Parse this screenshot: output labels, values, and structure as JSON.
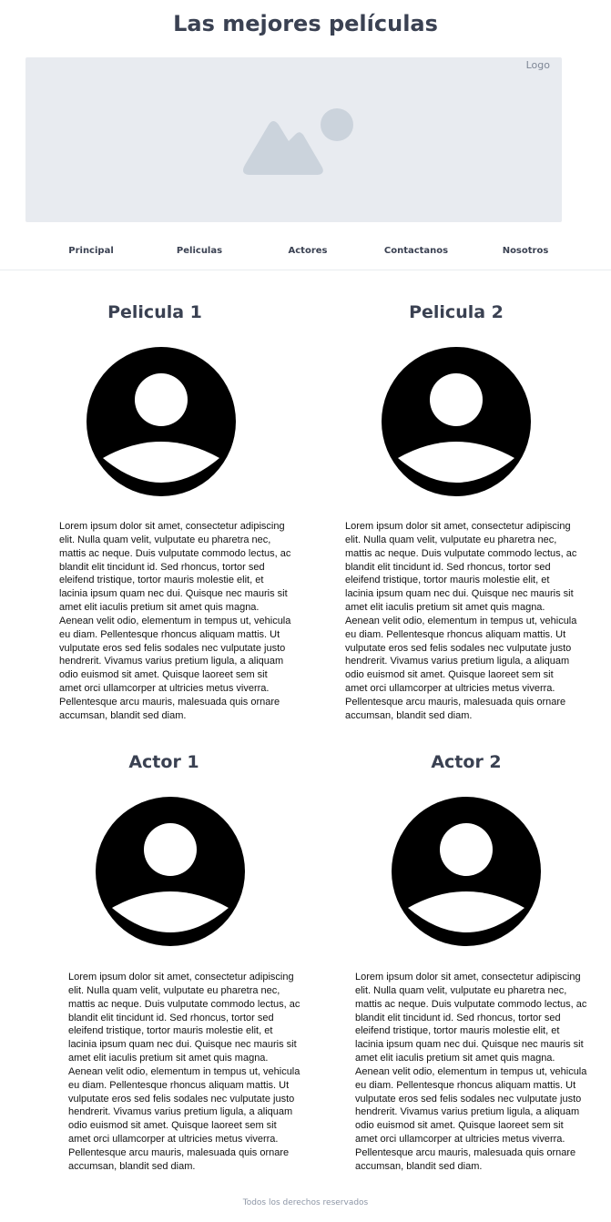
{
  "header": {
    "title": "Las mejores películas"
  },
  "banner": {
    "logo_label": "Logo",
    "image_icon": "image-placeholder-icon"
  },
  "nav": {
    "items": [
      {
        "label": "Principal"
      },
      {
        "label": "Peliculas"
      },
      {
        "label": "Actores"
      },
      {
        "label": "Contactanos"
      },
      {
        "label": "Nosotros"
      }
    ]
  },
  "cards": [
    {
      "title": "Pelicula 1",
      "icon": "user-avatar-icon",
      "text": "Lorem ipsum dolor sit amet, consectetur adipiscing elit. Nulla quam velit, vulputate eu pharetra nec, mattis ac neque. Duis vulputate commodo lectus, ac blandit elit tincidunt id. Sed rhoncus, tortor sed eleifend tristique, tortor mauris molestie elit, et lacinia ipsum quam nec dui. Quisque nec mauris sit amet elit iaculis pretium sit amet quis magna. Aenean velit odio, elementum in tempus ut, vehicula eu diam. Pellentesque rhoncus aliquam mattis. Ut vulputate eros sed felis sodales nec vulputate justo hendrerit. Vivamus varius pretium ligula, a aliquam odio euismod sit amet. Quisque laoreet sem sit amet orci ullamcorper at ultricies metus viverra. Pellentesque arcu mauris, malesuada quis ornare accumsan, blandit sed diam."
    },
    {
      "title": "Pelicula 2",
      "icon": "user-avatar-icon",
      "text": "Lorem ipsum dolor sit amet, consectetur adipiscing elit. Nulla quam velit, vulputate eu pharetra nec, mattis ac neque. Duis vulputate commodo lectus, ac blandit elit tincidunt id. Sed rhoncus, tortor sed eleifend tristique, tortor mauris molestie elit, et lacinia ipsum quam nec dui. Quisque nec mauris sit amet elit iaculis pretium sit amet quis magna. Aenean velit odio, elementum in tempus ut, vehicula eu diam. Pellentesque rhoncus aliquam mattis. Ut vulputate eros sed felis sodales nec vulputate justo hendrerit. Vivamus varius pretium ligula, a aliquam odio euismod sit amet. Quisque laoreet sem sit amet orci ullamcorper at ultricies metus viverra. Pellentesque arcu mauris, malesuada quis ornare accumsan, blandit sed diam."
    },
    {
      "title": "Actor 1",
      "icon": "user-avatar-icon",
      "text": "Lorem ipsum dolor sit amet, consectetur adipiscing elit. Nulla quam velit, vulputate eu pharetra nec, mattis ac neque. Duis vulputate commodo lectus, ac blandit elit tincidunt id. Sed rhoncus, tortor sed eleifend tristique, tortor mauris molestie elit, et lacinia ipsum quam nec dui. Quisque nec mauris sit amet elit iaculis pretium sit amet quis magna. Aenean velit odio, elementum in tempus ut, vehicula eu diam. Pellentesque rhoncus aliquam mattis. Ut vulputate eros sed felis sodales nec vulputate justo hendrerit. Vivamus varius pretium ligula, a aliquam odio euismod sit amet. Quisque laoreet sem sit amet orci ullamcorper at ultricies metus viverra. Pellentesque arcu mauris, malesuada quis ornare accumsan, blandit sed diam."
    },
    {
      "title": "Actor 2",
      "icon": "user-avatar-icon",
      "text": "Lorem ipsum dolor sit amet, consectetur adipiscing elit. Nulla quam velit, vulputate eu pharetra nec, mattis ac neque. Duis vulputate commodo lectus, ac blandit elit tincidunt id. Sed rhoncus, tortor sed eleifend tristique, tortor mauris molestie elit, et lacinia ipsum quam nec dui. Quisque nec mauris sit amet elit iaculis pretium sit amet quis magna. Aenean velit odio, elementum in tempus ut, vehicula eu diam. Pellentesque rhoncus aliquam mattis. Ut vulputate eros sed felis sodales nec vulputate justo hendrerit. Vivamus varius pretium ligula, a aliquam odio euismod sit amet. Quisque laoreet sem sit amet orci ullamcorper at ultricies metus viverra. Pellentesque arcu mauris, malesuada quis ornare accumsan, blandit sed diam."
    }
  ],
  "footer": {
    "text": "Todos los derechos reservados"
  },
  "colors": {
    "heading": "#3a4152",
    "banner_bg": "#e8ebf0",
    "placeholder_icon": "#cbd3dc",
    "muted": "#8d96a6"
  }
}
